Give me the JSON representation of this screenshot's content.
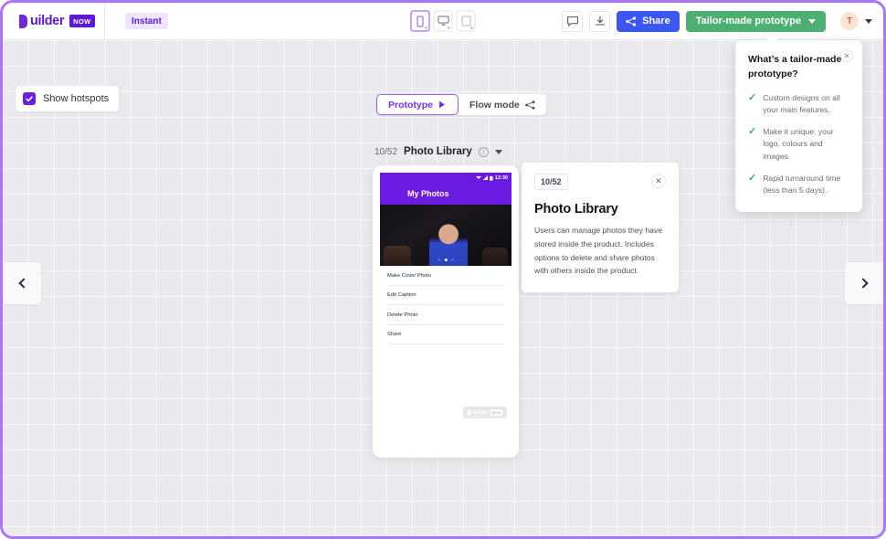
{
  "header": {
    "logo_text": "uilder",
    "logo_badge": "NOW",
    "instant_badge": "Instant",
    "devices": [
      {
        "name": "mobile",
        "active": true
      },
      {
        "name": "desktop",
        "active": false
      },
      {
        "name": "tablet",
        "active": false
      }
    ],
    "comment_icon": "comment-icon",
    "download_icon": "download-icon",
    "share_label": "Share",
    "tailor_label": "Tailor-made prototype",
    "avatar_initial": "T",
    "colors": {
      "brand_purple": "#5b19d6",
      "share_blue": "#3b57f0",
      "tailor_green": "#4cb072",
      "frame_purple": "#a974ff"
    }
  },
  "canvas": {
    "hotspots_label": "Show hotspots",
    "hotspots_checked": true,
    "modes": [
      {
        "label": "Prototype",
        "active": true,
        "icon": "play-icon"
      },
      {
        "label": "Flow mode",
        "active": false,
        "icon": "flow-icon"
      }
    ],
    "screen_label": {
      "count": "10/52",
      "title": "Photo Library",
      "info_icon": "info-icon",
      "caret_icon": "chevron-down-icon"
    }
  },
  "phone": {
    "status_time": "12:30",
    "appbar_title": "My Photos",
    "carousel_dots": 3,
    "carousel_active_index": 1,
    "menu_items": [
      "Make Cover Photo",
      "Edit Caption",
      "Delete Photo",
      "Share"
    ],
    "watermark_text": "uilder",
    "watermark_badge": "NOW"
  },
  "info_card": {
    "badge": "10/52",
    "close_icon": "close-icon",
    "title": "Photo Library",
    "body": "Users can manage photos they have stored inside the product. Includes options to delete and share photos with others inside the product."
  },
  "tooltip": {
    "title": "What’s a tailor-made prototype?",
    "close_icon": "close-icon",
    "items": [
      "Custom designs on all your main features.",
      "Make it unique: your logo, colours and images.",
      "Rapid turnaround time (less than 5 days)."
    ]
  },
  "nav": {
    "prev_icon": "chevron-left-icon",
    "next_icon": "chevron-right-icon"
  }
}
